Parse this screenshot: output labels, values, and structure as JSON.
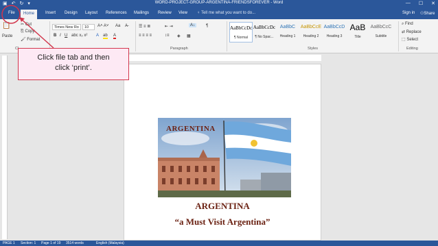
{
  "window": {
    "title": "WORD-PROJECT-GROUP-ARGENTINA-FRIENDSFOREVER - Word",
    "controls": [
      "—",
      "☐",
      "✕"
    ]
  },
  "tabs": [
    {
      "label": "File"
    },
    {
      "label": "Home"
    },
    {
      "label": "Insert"
    },
    {
      "label": "Design"
    },
    {
      "label": "Layout"
    },
    {
      "label": "References"
    },
    {
      "label": "Mailings"
    },
    {
      "label": "Review"
    },
    {
      "label": "View"
    }
  ],
  "tell_me": "Tell me what you want to do...",
  "account": {
    "sign_in": "Sign in",
    "share": "Share"
  },
  "ribbon": {
    "paste": "Paste",
    "cut": "Cut",
    "copy": "Copy",
    "format_painter": "Format",
    "clipboard_label": "Cl",
    "font_name": "Times New Ro",
    "font_size": "10",
    "paragraph_label": "Paragraph",
    "styles_label": "Styles",
    "editing_label": "Editing",
    "find": "Find",
    "replace": "Replace",
    "select": "Select",
    "styles": [
      {
        "sample": "AaBbCcDc",
        "name": "¶ Normal"
      },
      {
        "sample": "AaBbCcDc",
        "name": "¶ No Spac..."
      },
      {
        "sample": "AaBbC",
        "name": "Heading 1"
      },
      {
        "sample": "AaBbCcE",
        "name": "Heading 2"
      },
      {
        "sample": "AaBbCcD",
        "name": "Heading 3"
      },
      {
        "sample": "AaB",
        "name": "Title"
      },
      {
        "sample": "AaBbCcC",
        "name": "Subtitle"
      }
    ]
  },
  "document": {
    "image_caption": "ARGENTINA",
    "title": "ARGENTINA",
    "subtitle": "“a Must Visit Argentina”"
  },
  "status": {
    "page": "PAGE 1",
    "section": "Section: 1",
    "page_of": "Page 1 of 19",
    "words": "3514 words",
    "language": "English (Malaysia)"
  },
  "callout": {
    "line1": "Click file tab and then",
    "line2": "click ‘print’."
  },
  "colors": {
    "word_blue": "#2b579a",
    "callout_border": "#d2364c",
    "callout_fill": "#fde9f4",
    "title_brown": "#6b2213"
  }
}
